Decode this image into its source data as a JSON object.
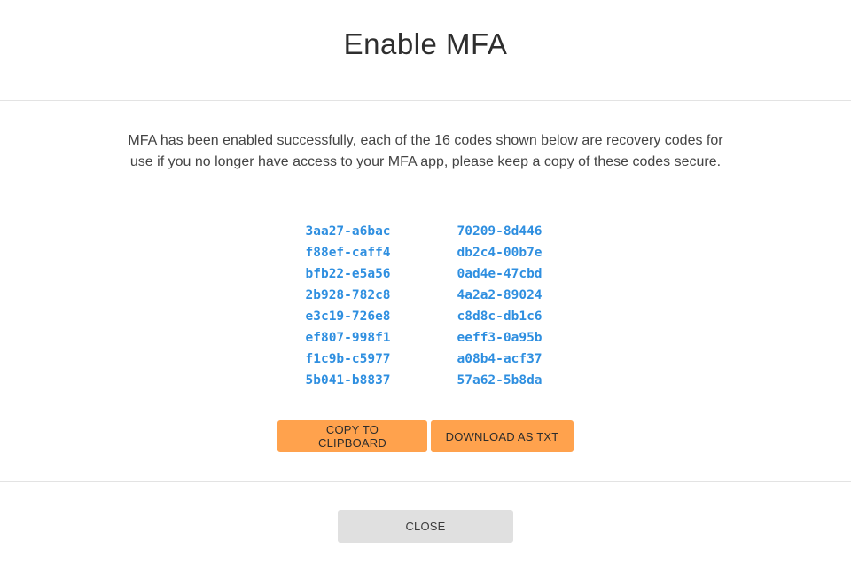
{
  "dialog": {
    "title": "Enable MFA",
    "intro": "MFA has been enabled successfully, each of the 16 codes shown below are recovery codes for use if you no longer have access to your MFA app, please keep a copy of these codes secure."
  },
  "recovery_codes": [
    "3aa27-a6bac",
    "70209-8d446",
    "f88ef-caff4",
    "db2c4-00b7e",
    "bfb22-e5a56",
    "0ad4e-47cbd",
    "2b928-782c8",
    "4a2a2-89024",
    "e3c19-726e8",
    "c8d8c-db1c6",
    "ef807-998f1",
    "eeff3-0a95b",
    "f1c9b-c5977",
    "a08b4-acf37",
    "5b041-b8837",
    "57a62-5b8da"
  ],
  "actions": {
    "copy_label": "COPY TO CLIPBOARD",
    "download_label": "DOWNLOAD AS TXT"
  },
  "footer": {
    "close_label": "CLOSE"
  },
  "colors": {
    "accent_orange": "#ffa24d",
    "code_blue": "#2f8fe0",
    "close_grey": "#e0e0e0"
  }
}
